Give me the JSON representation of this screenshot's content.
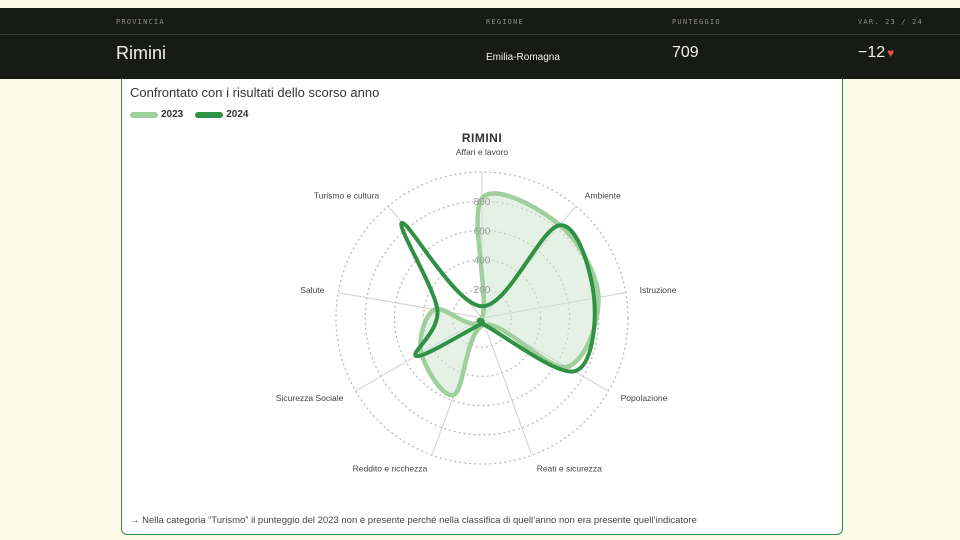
{
  "header": {
    "columns": [
      {
        "label": "PROVINCIA",
        "value": "Rimini"
      },
      {
        "label": "REGIONE",
        "value": "Emilia-Romagna"
      },
      {
        "label": "PUNTEGGIO",
        "value": "709"
      },
      {
        "label": "VAR. 23 / 24",
        "value": "−12"
      }
    ]
  },
  "card": {
    "title": "Confrontato con i risultati dello scorso anno",
    "footnote": "→ Nella categoria “Turismo” il punteggio del 2023 non è presente perché nella classifica di quell’anno non era presente quell’indicatore"
  },
  "colors": {
    "s2023": "#9fcf9c",
    "s2024": "#2f9143",
    "fill": "#cfe6cf",
    "header_bg": "#171a15",
    "trend_down": "#e0533e"
  },
  "icons": {
    "trend": "heart-icon",
    "edge": "chevron-left-icon"
  },
  "chart_data": {
    "type": "radar",
    "title": "RIMINI",
    "categories": [
      "Affari e lavoro",
      "Ambiente",
      "Istruzione",
      "Popolazione",
      "Reati e sicurezza",
      "Reddito e ricchezza",
      "Sicurezza Sociale",
      "Salute",
      "Turismo e cultura"
    ],
    "rticks": [
      200,
      400,
      600,
      800
    ],
    "rlim": [
      0,
      1000
    ],
    "legend": [
      "2023",
      "2024"
    ],
    "series": [
      {
        "name": "2023",
        "values": [
          820,
          830,
          810,
          670,
          50,
          560,
          480,
          330,
          null
        ]
      },
      {
        "name": "2024",
        "values": [
          80,
          830,
          780,
          730,
          50,
          50,
          520,
          310,
          850
        ]
      }
    ]
  }
}
